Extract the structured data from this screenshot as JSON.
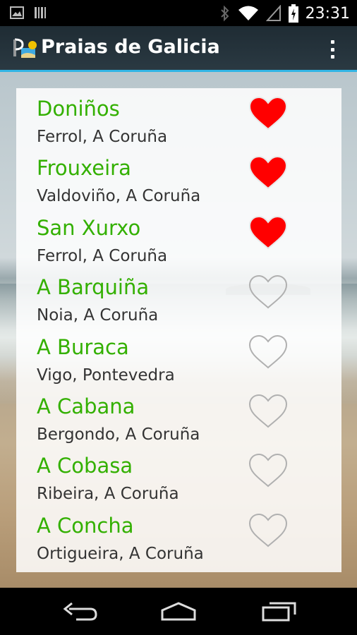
{
  "status_bar": {
    "time": "23:31",
    "left_icons": [
      "image-notification-icon",
      "barcode-notification-icon"
    ],
    "right_icons": [
      "bluetooth-icon",
      "wifi-icon",
      "signal-icon",
      "battery-charging-icon"
    ]
  },
  "app_bar": {
    "title": "Praias de Galicia",
    "logo_icon": "app-logo-icon",
    "menu_icon": "overflow-menu-icon",
    "accent_color": "#33b5e5"
  },
  "beaches": [
    {
      "name": "Doniños",
      "location": "Ferrol, A Coruña",
      "favorite": true
    },
    {
      "name": "Frouxeira",
      "location": "Valdoviño, A Coruña",
      "favorite": true
    },
    {
      "name": "San Xurxo",
      "location": "Ferrol, A Coruña",
      "favorite": true
    },
    {
      "name": "A Barquiña",
      "location": "Noia, A Coruña",
      "favorite": false
    },
    {
      "name": "A Buraca",
      "location": "Vigo, Pontevedra",
      "favorite": false
    },
    {
      "name": "A Cabana",
      "location": "Bergondo, A Coruña",
      "favorite": false
    },
    {
      "name": "A Cobasa",
      "location": "Ribeira, A Coruña",
      "favorite": false
    },
    {
      "name": "A Concha",
      "location": "Ortigueira, A Coruña",
      "favorite": false
    }
  ],
  "colors": {
    "beach_name": "#33b000",
    "heart_favorite": "#ff0000",
    "heart_outline": "#b0b0b0"
  },
  "nav_bar": {
    "buttons": [
      "back-icon",
      "home-icon",
      "recent-apps-icon"
    ]
  }
}
